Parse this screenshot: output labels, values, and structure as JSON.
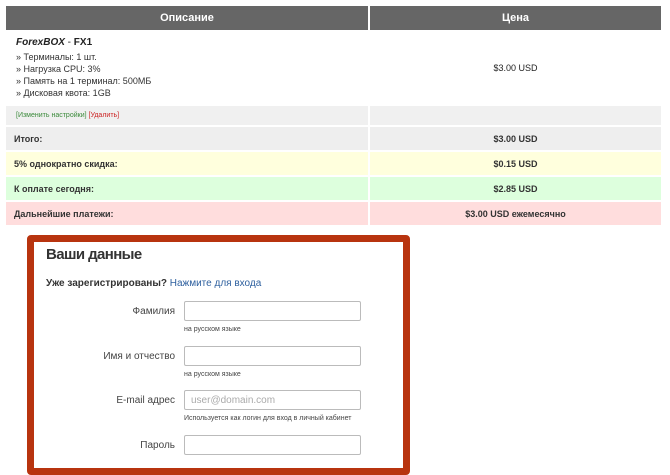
{
  "cart": {
    "headers": {
      "description": "Описание",
      "price": "Цена"
    },
    "product": {
      "brand": "ForexBOX",
      "separator": " - ",
      "model": "FX1",
      "specs": [
        "» Терминалы: 1 шт.",
        "» Нагрузка CPU: 3%",
        "» Память на 1 терминал: 500МБ",
        "» Дисковая квота: 1GB"
      ],
      "price": "$3.00 USD",
      "edit_link": "[Изменить настройки]",
      "delete_link": "[Удалить]"
    },
    "summary": {
      "total_label": "Итого:",
      "total_value": "$3.00 USD",
      "discount_label": "5% однократно скидка:",
      "discount_value": "$0.15 USD",
      "today_label": "К оплате сегодня:",
      "today_value": "$2.85 USD",
      "future_label": "Дальнейшие платежи:",
      "future_value": "$3.00 USD ежемесячно"
    }
  },
  "form": {
    "title": "Ваши данные",
    "login_prompt": "Уже зарегистрированы?",
    "login_link": "Нажмите для входа",
    "fields": [
      {
        "label": "Фамилия",
        "value": "",
        "placeholder": "",
        "hint": "на русском языке"
      },
      {
        "label": "Имя и отчество",
        "value": "",
        "placeholder": "",
        "hint": "на русском языке"
      },
      {
        "label": "E-mail адрес",
        "value": "",
        "placeholder": "user@domain.com",
        "hint": "Используется как логин для вход в личный кабинет"
      },
      {
        "label": "Пароль",
        "value": "",
        "placeholder": "",
        "hint": ""
      }
    ]
  },
  "colors": {
    "header_bg": "#666666",
    "panel_border": "#b8340f",
    "discount_bg": "#ffffdd",
    "today_bg": "#ddffdd",
    "future_bg": "#ffdddd"
  }
}
